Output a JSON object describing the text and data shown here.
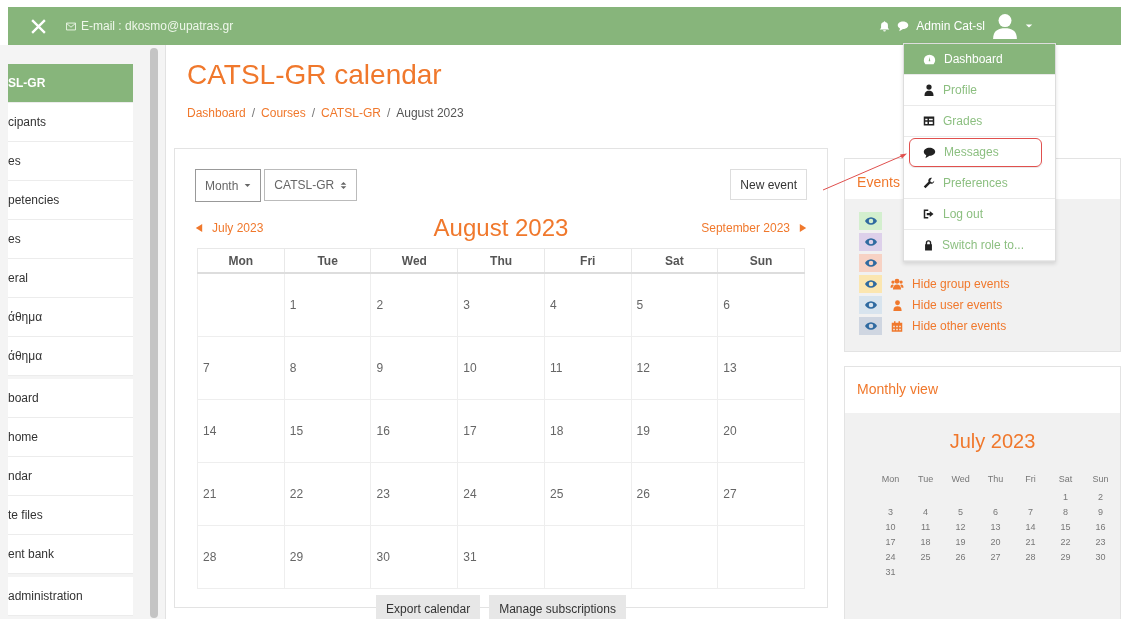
{
  "topbar": {
    "email": "E-mail : dkosmo@upatras.gr",
    "user": "Admin Cat-sl"
  },
  "sidebar": {
    "groups": [
      [
        {
          "label": "SL-GR",
          "selected": true
        },
        {
          "label": "cipants",
          "selected": false
        },
        {
          "label": "es",
          "selected": false
        },
        {
          "label": "petencies",
          "selected": false
        },
        {
          "label": "es",
          "selected": false
        },
        {
          "label": "eral",
          "selected": false
        },
        {
          "label": "άθημα",
          "selected": false
        },
        {
          "label": "άθημα",
          "selected": false
        }
      ],
      [
        {
          "label": "board",
          "selected": false
        },
        {
          "label": "home",
          "selected": false
        },
        {
          "label": "ndar",
          "selected": false
        },
        {
          "label": "te files",
          "selected": false
        },
        {
          "label": "ent bank",
          "selected": false
        }
      ],
      [
        {
          "label": "administration",
          "selected": false
        }
      ]
    ]
  },
  "page": {
    "title": "CATSL-GR calendar",
    "breadcrumb": [
      {
        "label": "Dashboard",
        "kind": "link"
      },
      {
        "label": "/",
        "kind": "separator"
      },
      {
        "label": "Courses",
        "kind": "link"
      },
      {
        "label": "/",
        "kind": "separator"
      },
      {
        "label": "CATSL-GR",
        "kind": "link"
      },
      {
        "label": "/",
        "kind": "separator"
      },
      {
        "label": "August 2023",
        "kind": "current"
      }
    ]
  },
  "calendar": {
    "view_select": "Month",
    "course_select": "CATSL-GR",
    "new_event": "New event",
    "prev": "July 2023",
    "title": "August 2023",
    "next": "September 2023",
    "weekdays": [
      "Mon",
      "Tue",
      "Wed",
      "Thu",
      "Fri",
      "Sat",
      "Sun"
    ],
    "weeks": [
      {
        "tue": "1",
        "wed": "2",
        "thu": "3",
        "fri": "4",
        "sat": "5",
        "sun": "6"
      },
      {
        "mon": "7",
        "tue": "8",
        "wed": "9",
        "thu": "10",
        "fri": "11",
        "sat": "12",
        "sun": "13"
      },
      {
        "mon": "14",
        "tue": "15",
        "wed": "16",
        "thu": "17",
        "fri": "18",
        "sat": "19",
        "sun": "20"
      },
      {
        "mon": "21",
        "tue": "22",
        "wed": "23",
        "thu": "24",
        "fri": "25",
        "sat": "26",
        "sun": "27"
      },
      {
        "mon": "28",
        "tue": "29",
        "wed": "30",
        "thu": "31"
      }
    ],
    "buttons": [
      "Export calendar",
      "Manage subscriptions"
    ]
  },
  "events_card": {
    "title": "Events",
    "items": [
      {
        "color": "#d3efce"
      },
      {
        "color": "#ddd0ea"
      },
      {
        "color": "#f7d2c4"
      },
      {
        "color": "#fbe6b0",
        "kind": "group",
        "label": "Hide group events"
      },
      {
        "color": "#d8e4ee",
        "kind": "user",
        "label": "Hide user events"
      },
      {
        "color": "#cfd6e1",
        "kind": "other",
        "label": "Hide other events"
      }
    ]
  },
  "monthly_view": {
    "title": "Monthly view",
    "month": "July 2023",
    "weekdays": [
      "Mon",
      "Tue",
      "Wed",
      "Thu",
      "Fri",
      "Sat",
      "Sun"
    ],
    "weeks": [
      {
        "sat": "1",
        "sun": "2"
      },
      {
        "mon": "3",
        "tue": "4",
        "wed": "5",
        "thu": "6",
        "fri": "7",
        "sat": "8",
        "sun": "9"
      },
      {
        "mon": "10",
        "tue": "11",
        "wed": "12",
        "thu": "13",
        "fri": "14",
        "sat": "15",
        "sun": "16"
      },
      {
        "mon": "17",
        "tue": "18",
        "wed": "19",
        "thu": "20",
        "fri": "21",
        "sat": "22",
        "sun": "23"
      },
      {
        "mon": "24",
        "tue": "25",
        "wed": "26",
        "thu": "27",
        "fri": "28",
        "sat": "29",
        "sun": "30"
      },
      {
        "mon": "31"
      }
    ]
  },
  "user_menu": {
    "items": [
      {
        "label": "Dashboard",
        "kind": "dashboard",
        "selected": true,
        "highlighted": false
      },
      {
        "label": "Profile",
        "kind": "profile",
        "selected": false,
        "highlighted": false
      },
      {
        "label": "Grades",
        "kind": "grades",
        "selected": false,
        "highlighted": false
      },
      {
        "label": "Messages",
        "kind": "messages",
        "selected": false,
        "highlighted": true
      },
      {
        "label": "Preferences",
        "kind": "preferences",
        "selected": false,
        "highlighted": false
      },
      {
        "label": "Log out",
        "kind": "logout",
        "selected": false,
        "highlighted": false
      },
      {
        "label": "Switch role to...",
        "kind": "switchrole",
        "selected": false,
        "highlighted": false
      }
    ]
  }
}
